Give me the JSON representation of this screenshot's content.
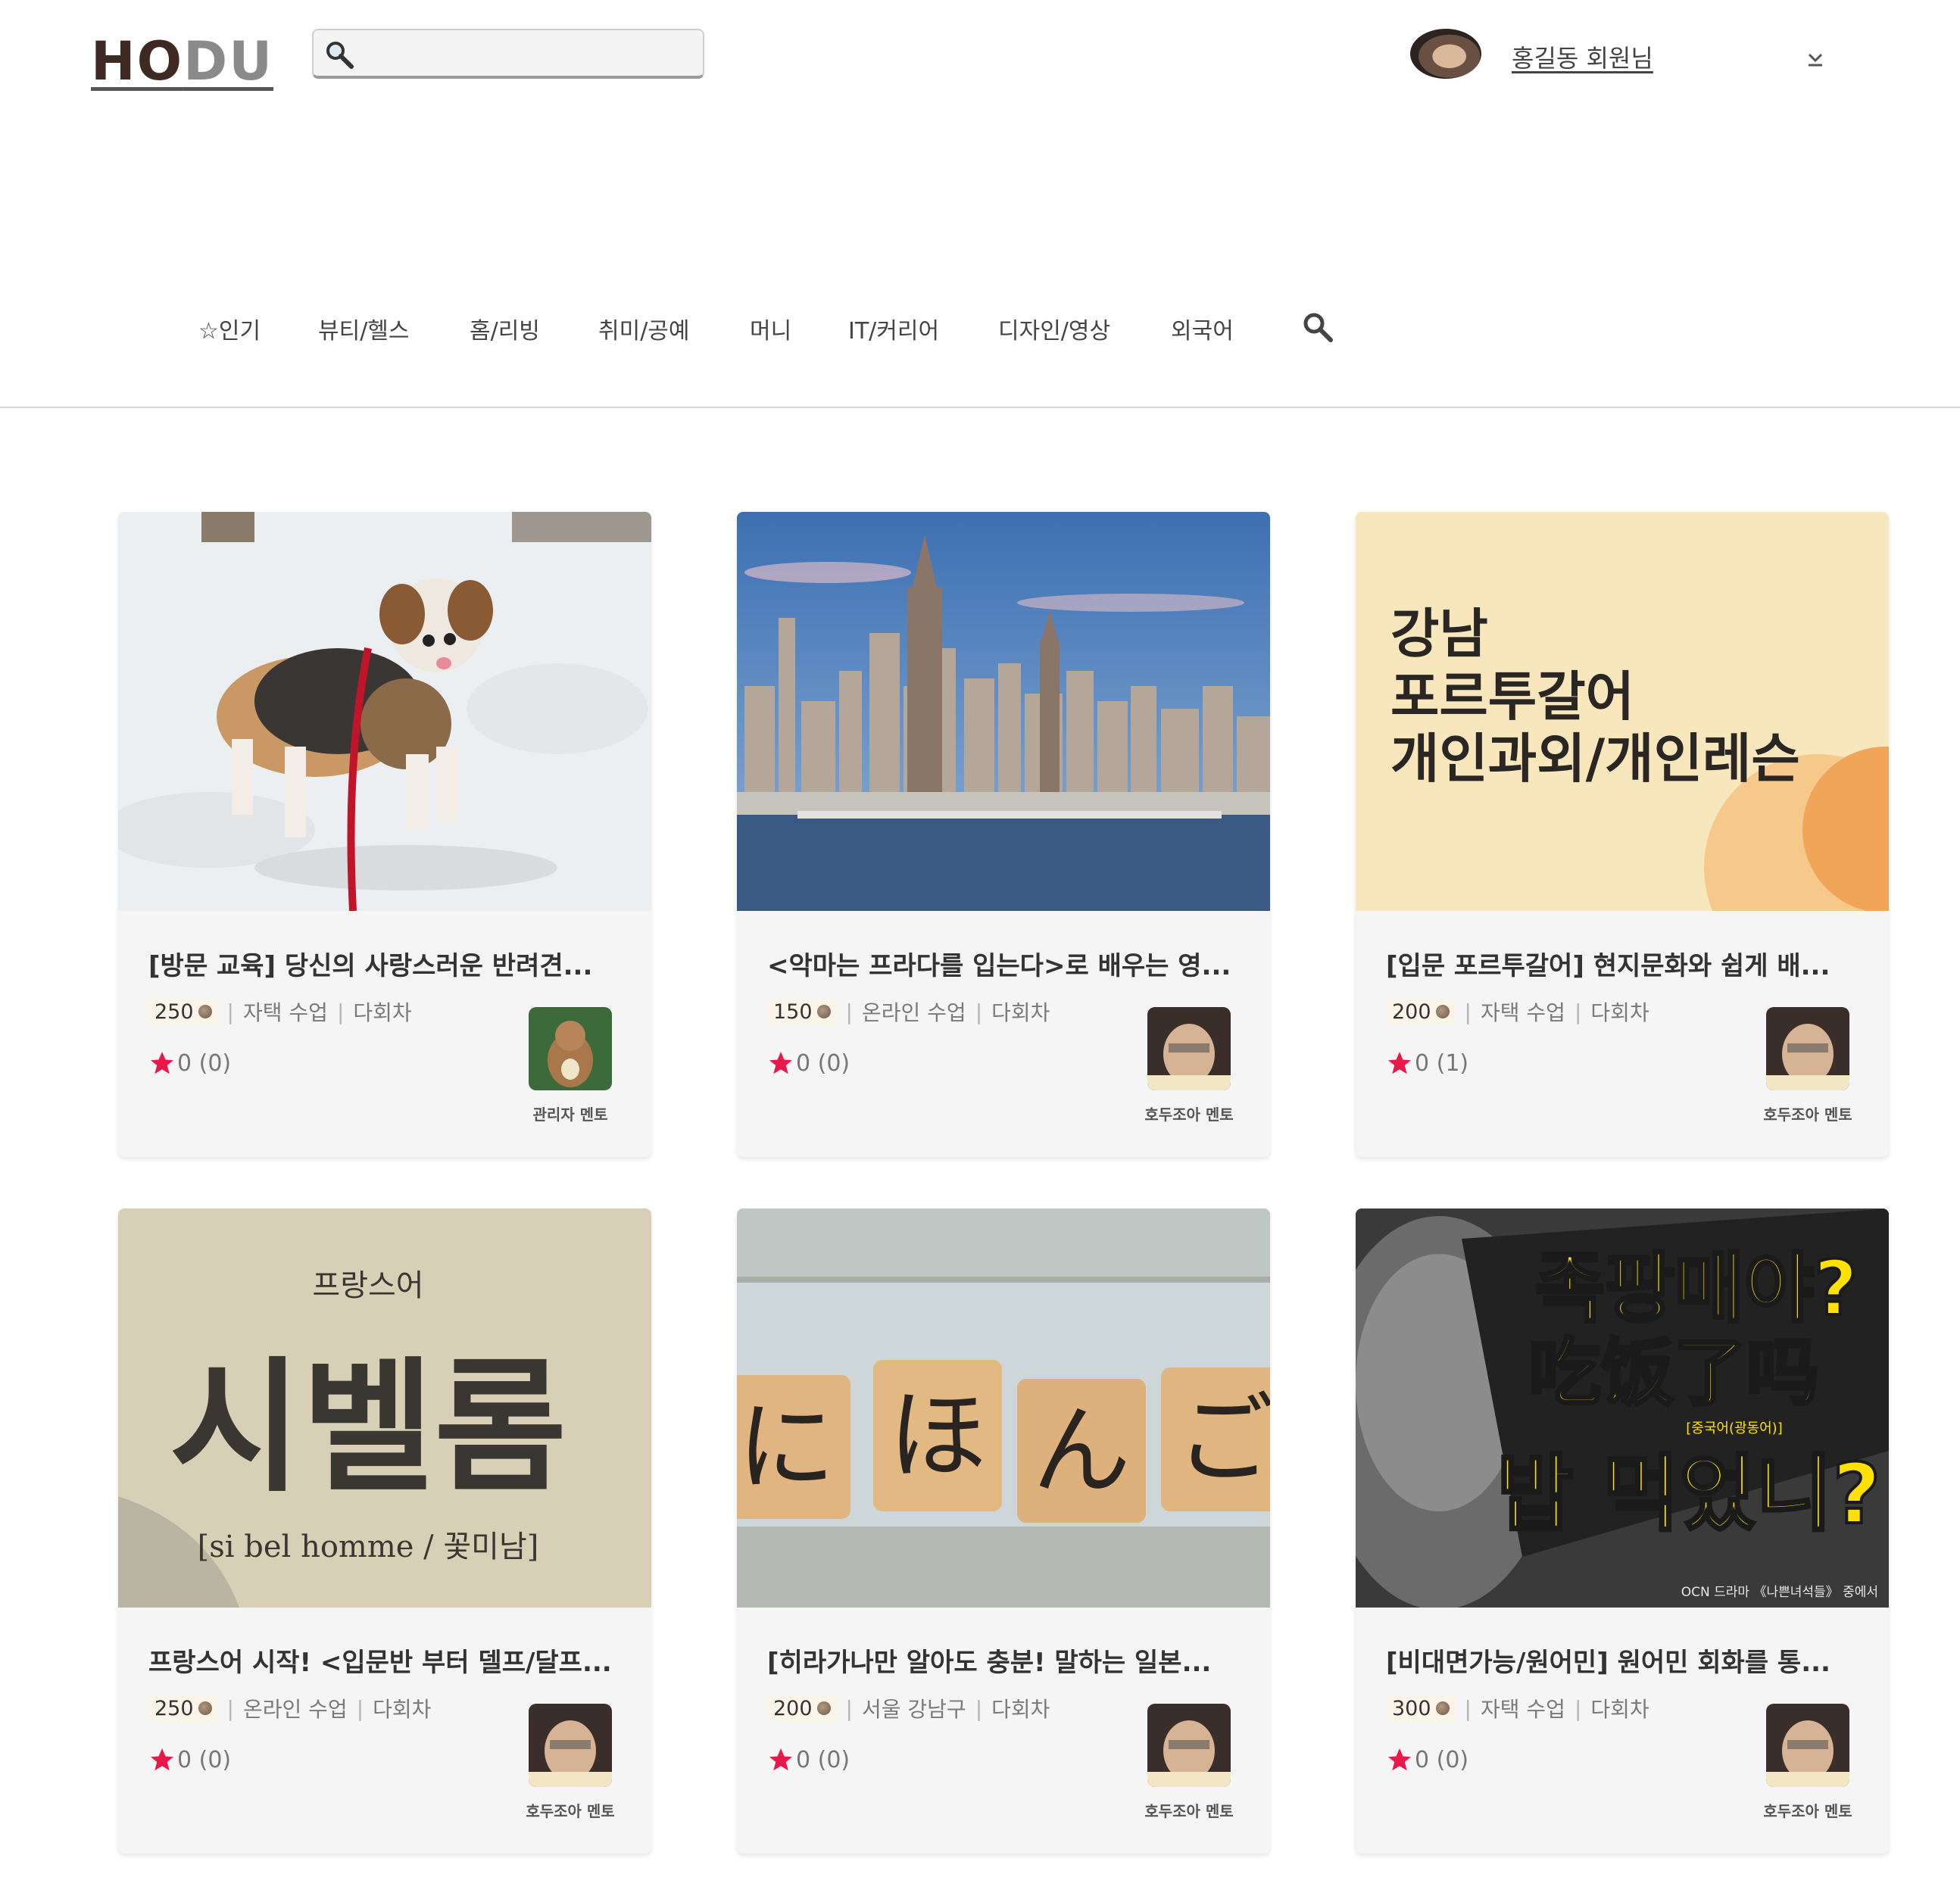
{
  "header": {
    "logo_ho": "HO",
    "logo_du": "DU",
    "search_placeholder": "",
    "user_name": "홍길동 회원님"
  },
  "nav": {
    "items": [
      "☆인기",
      "뷰티/헬스",
      "홈/리빙",
      "취미/공예",
      "머니",
      "IT/커리어",
      "디자인/영상",
      "외국어"
    ]
  },
  "thumb_text": {
    "portuguese": [
      "강남",
      "포르투갈어",
      "개인과외/개인레슨"
    ],
    "french": {
      "top": "프랑스어",
      "big": "시벨롬",
      "sub": "[si bel homme / 꽃미남]"
    },
    "japanese": [
      "に",
      "ほ",
      "ん",
      "ご"
    ],
    "chinese": {
      "line1": "족팡매야?",
      "line2": "吃饭了吗",
      "tag": "[중국어(광동어)]",
      "line3": "밥 먹었니?",
      "credit": "OCN 드라마 《나쁜녀석들》 중에서"
    }
  },
  "cards": [
    {
      "title": "[방문 교육] 당신의 사랑스러운 반려견...",
      "price": "250",
      "mode": "자택 수업",
      "sessions": "다회차",
      "rating": "0 (0)",
      "mentor": "관리자 멘토"
    },
    {
      "title": "<악마는 프라다를 입는다>로 배우는 영...",
      "price": "150",
      "mode": "온라인 수업",
      "sessions": "다회차",
      "rating": "0 (0)",
      "mentor": "호두조아 멘토"
    },
    {
      "title": "[입문 포르투갈어] 현지문화와 쉽게 배...",
      "price": "200",
      "mode": "자택 수업",
      "sessions": "다회차",
      "rating": "0 (1)",
      "mentor": "호두조아 멘토"
    },
    {
      "title": "프랑스어 시작! <입문반 부터 델프/달프...",
      "price": "250",
      "mode": "온라인 수업",
      "sessions": "다회차",
      "rating": "0 (0)",
      "mentor": "호두조아 멘토"
    },
    {
      "title": "[히라가나만 알아도 충분! 말하는 일본...",
      "price": "200",
      "mode": "서울 강남구",
      "sessions": "다회차",
      "rating": "0 (0)",
      "mentor": "호두조아 멘토"
    },
    {
      "title": "[비대면가능/원어민] 원어민 회화를 통...",
      "price": "300",
      "mode": "자택 수업",
      "sessions": "다회차",
      "rating": "0 (0)",
      "mentor": "호두조아 멘토"
    }
  ],
  "colors": {
    "logo": "#3e2a22",
    "star": "#e8184a",
    "divider": "#d6d6d6",
    "card_bg": "#f5f5f5"
  }
}
